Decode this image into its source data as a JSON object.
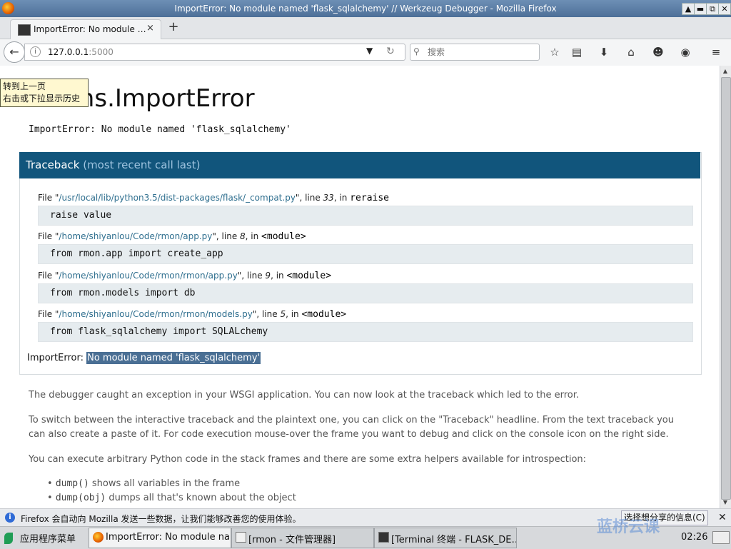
{
  "window": {
    "title": "ImportError: No module named 'flask_sqlalchemy' // Werkzeug Debugger - Mozilla Firefox",
    "buttons": [
      "▲",
      "▬",
      "⧉",
      "✕"
    ]
  },
  "tabs": [
    {
      "label": "ImportError: No module …",
      "close": "×"
    }
  ],
  "new_tab": "+",
  "nav": {
    "back": "←",
    "info": "i",
    "url_host": "127.0.0.1",
    "url_port": ":5000",
    "dropdown": "▼",
    "reload": "↻",
    "search_icon": "⚲",
    "search_placeholder": "搜索",
    "toolbar_icons": [
      "star-icon",
      "reading-list-icon",
      "download-icon",
      "home-icon",
      "chat-icon",
      "pocket-icon",
      "menu-icon"
    ],
    "toolbar_glyphs": [
      "☆",
      "▤",
      "⬇",
      "⌂",
      "☻",
      "◉",
      "≡"
    ]
  },
  "tooltip": {
    "line1": "转到上一页",
    "line2": "右击或下拉显示历史"
  },
  "page": {
    "heading": "builtins.ImportError",
    "error_subtitle": "ImportError: No module named 'flask_sqlalchemy'",
    "traceback_title": "Traceback",
    "traceback_sub": " (most recent call last)",
    "frames": [
      {
        "prefix": "File \"",
        "path": "/usr/local/lib/python3.5/dist-packages/flask/_compat.py",
        "mid": "\", line ",
        "line": "33",
        "in": ", in ",
        "func": "reraise",
        "code": "raise value"
      },
      {
        "prefix": "File \"",
        "path": "/home/shiyanlou/Code/rmon/app.py",
        "mid": "\", line ",
        "line": "8",
        "in": ", in ",
        "func": "<module>",
        "code": "from rmon.app import create_app"
      },
      {
        "prefix": "File \"",
        "path": "/home/shiyanlou/Code/rmon/rmon/app.py",
        "mid": "\", line ",
        "line": "9",
        "in": ", in ",
        "func": "<module>",
        "code": "from rmon.models import db"
      },
      {
        "prefix": "File \"",
        "path": "/home/shiyanlou/Code/rmon/rmon/models.py",
        "mid": "\", line ",
        "line": "5",
        "in": ", in ",
        "func": "<module>",
        "code": "from flask_sqlalchemy import SQLALchemy"
      }
    ],
    "final_error_label": "ImportError: ",
    "final_error_msg": "No module named 'flask_sqlalchemy'",
    "para1": "The debugger caught an exception in your WSGI application. You can now look at the traceback which led to the error.",
    "para2": "To switch between the interactive traceback and the plaintext one, you can click on the \"Traceback\" headline. From the text traceback you can also create a paste of it. For code execution mouse-over the frame you want to debug and click on the console icon on the right side.",
    "para3": "You can execute arbitrary Python code in the stack frames and there are some extra helpers available for introspection:",
    "bullets": [
      {
        "code": "dump()",
        "text": " shows all variables in the frame"
      },
      {
        "code": "dump(obj)",
        "text": " dumps all that's known about the object"
      }
    ]
  },
  "notification": {
    "message": "Firefox 会自动向 Mozilla 发送一些数据，让我们能够改善您的使用体验。",
    "button": "选择想分享的信息(C)",
    "close": "✕"
  },
  "taskbar": {
    "start": "应用程序菜单",
    "tasks": [
      {
        "label": "ImportError: No module na…",
        "active": true
      },
      {
        "label": "[rmon - 文件管理器]",
        "active": false
      },
      {
        "label": "[Terminal 终端 - FLASK_DE…",
        "active": false
      }
    ],
    "watermark": "蓝桥云课",
    "clock": "02:26"
  },
  "colors": {
    "traceback_header": "#11557c",
    "code_bg": "#e6ecef",
    "path_link": "#2f6f8f",
    "highlight": "#4a6f94"
  }
}
